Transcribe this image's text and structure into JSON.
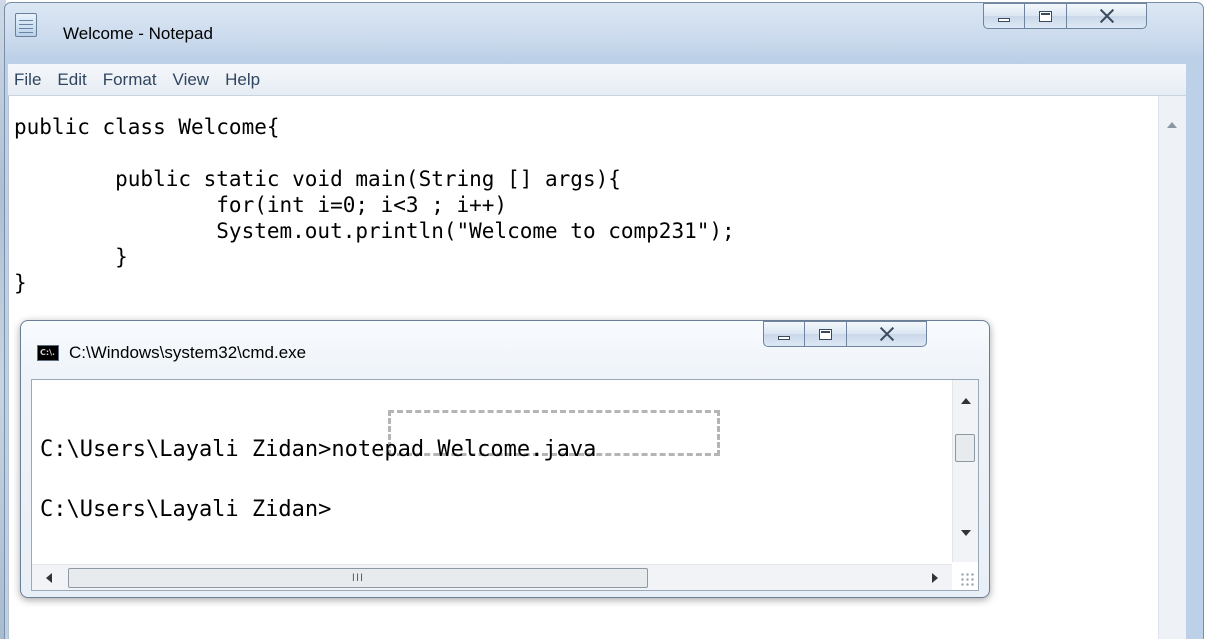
{
  "notepad": {
    "title": "Welcome - Notepad",
    "menu": [
      "File",
      "Edit",
      "Format",
      "View",
      "Help"
    ],
    "code": "public class Welcome{\n\n        public static void main(String [] args){\n                for(int i=0; i<3 ; i++)\n                System.out.println(\"Welcome to comp231\");\n        }\n}"
  },
  "cmd": {
    "title": "C:\\Windows\\system32\\cmd.exe",
    "icon_text": "C:\\.",
    "lines": [
      {
        "prompt": "C:\\Users\\Layali Zidan>",
        "command": "notepad Welcome.java"
      },
      {
        "prompt": "C:\\Users\\Layali Zidan>",
        "command": ""
      }
    ],
    "hscroll_grip": "III"
  },
  "icons": {
    "notepad_app": "notepad-icon",
    "cmd_app": "cmd-icon",
    "minimize": "minimize-icon",
    "maximize": "maximize-icon",
    "close": "close-icon"
  }
}
